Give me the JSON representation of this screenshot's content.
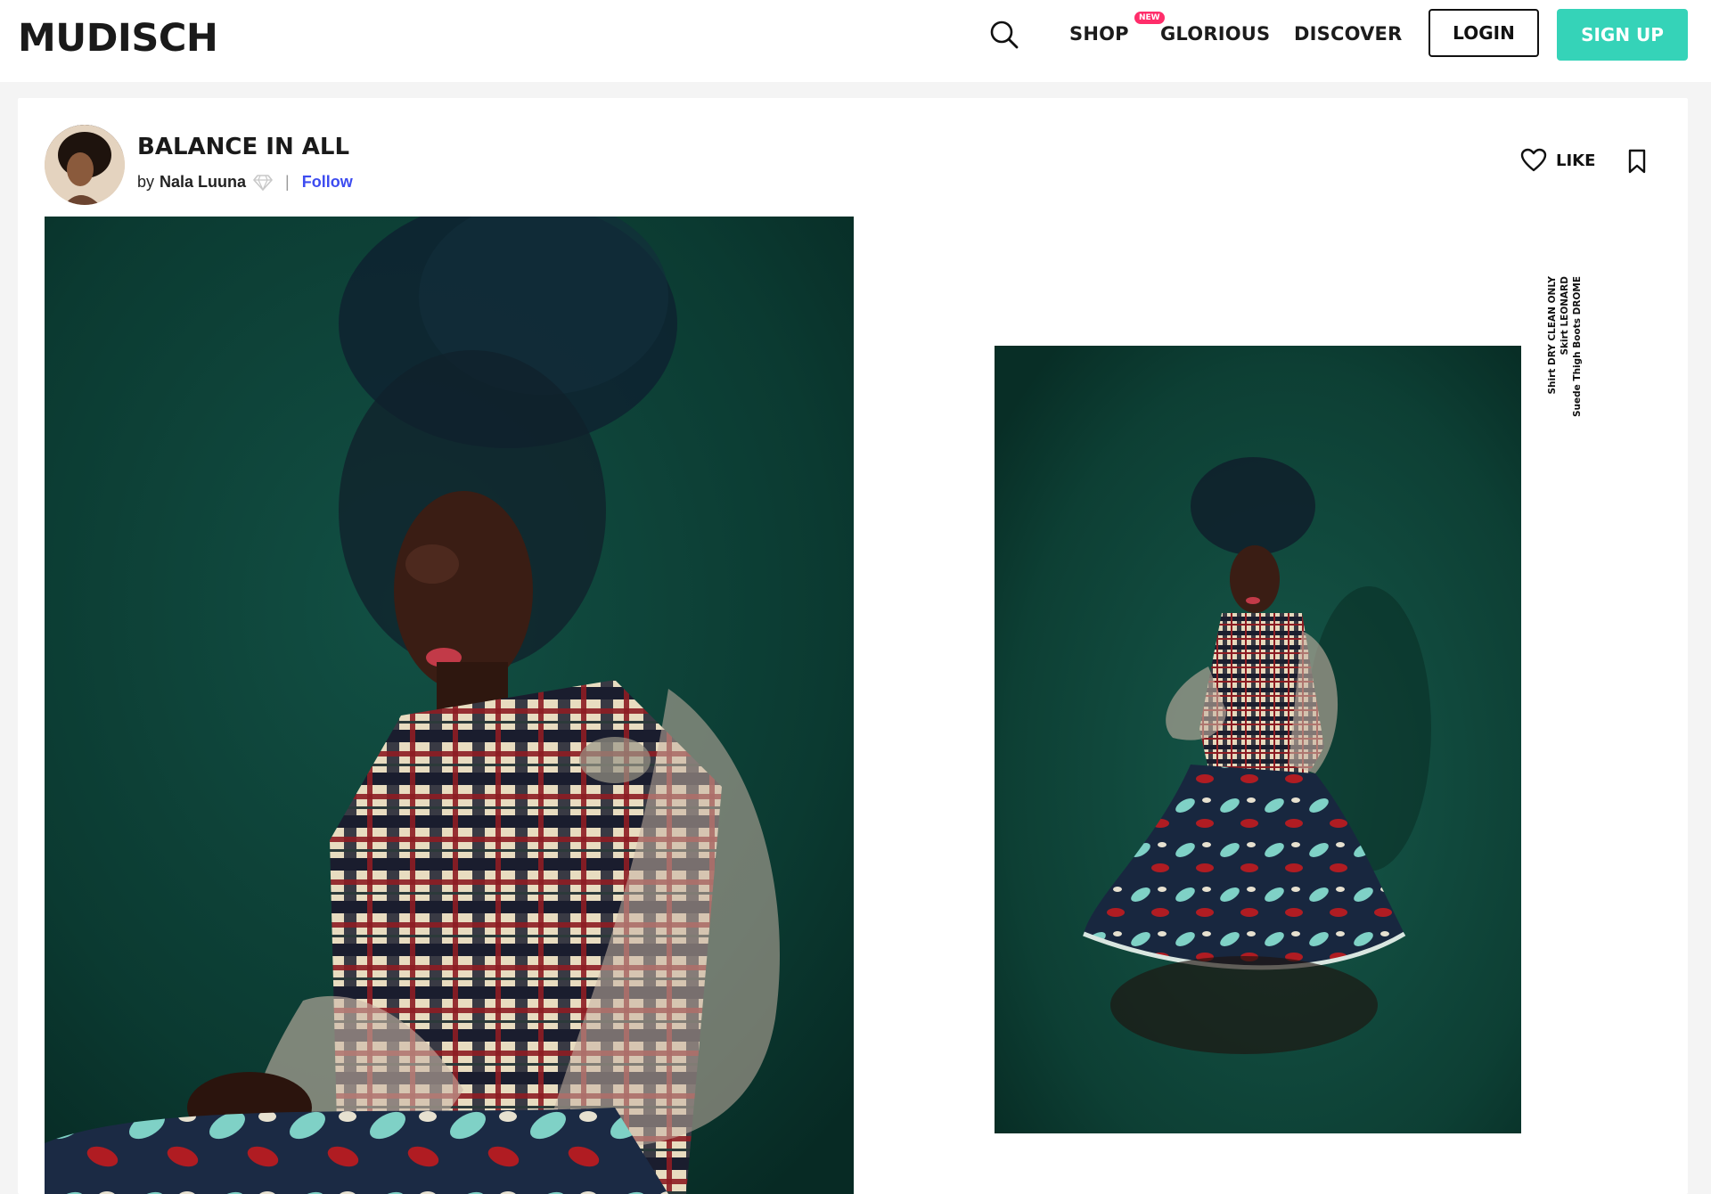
{
  "header": {
    "logo": "MUDISCH",
    "nav": {
      "shop": "SHOP",
      "new_badge": "NEW",
      "glorious": "GLORIOUS",
      "discover": "DISCOVER"
    },
    "login_label": "LOGIN",
    "signup_label": "SIGN UP"
  },
  "post": {
    "title": "BALANCE IN ALL",
    "by_label": "by",
    "author": "Nala Luuna",
    "separator": "|",
    "follow_label": "Follow",
    "like_label": "LIKE"
  },
  "credits": {
    "line1": "Shirt DRY CLEAN ONLY",
    "line2": "Skirt LEONARD",
    "line3": "Suede Thigh Boots DROME"
  },
  "colors": {
    "accent": "#35d3b8",
    "link": "#3d4cf0",
    "badge": "#ff2d6a",
    "photo_background": "#0d3b33"
  },
  "icons": {
    "search": "search-icon",
    "gem": "diamond-icon",
    "like": "heart-icon",
    "bookmark": "bookmark-icon"
  }
}
